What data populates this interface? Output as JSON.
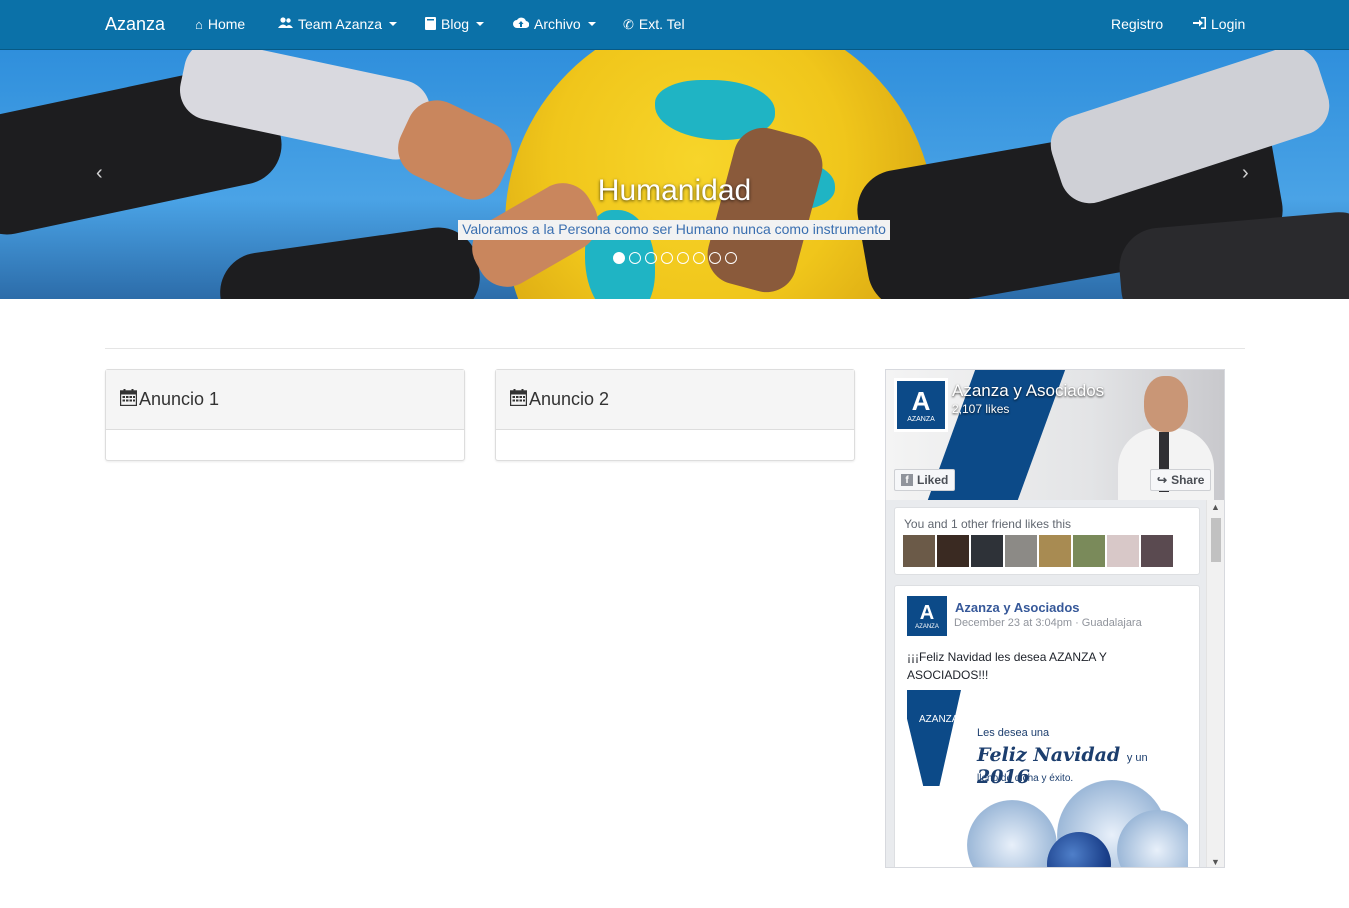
{
  "navbar": {
    "brand": "Azanza",
    "items": [
      {
        "label": "Home",
        "icon": "home-icon"
      },
      {
        "label": "Team Azanza",
        "icon": "users-icon",
        "dropdown": true
      },
      {
        "label": "Blog",
        "icon": "book-icon",
        "dropdown": true
      },
      {
        "label": "Archivo",
        "icon": "cloud-upload-icon",
        "dropdown": true
      },
      {
        "label": "Ext. Tel",
        "icon": "phone-icon"
      }
    ],
    "right": [
      {
        "label": "Registro"
      },
      {
        "label": "Login",
        "icon": "login-icon"
      }
    ]
  },
  "carousel": {
    "title": "Humanidad",
    "subtitle": "Valoramos a la Persona como ser Humano nunca como instrumento",
    "slide_count": 8,
    "active_index": 0,
    "prev": "‹",
    "next": "›"
  },
  "panels": [
    {
      "title": "Anuncio 1",
      "icon": "calendar-icon"
    },
    {
      "title": "Anuncio 2",
      "icon": "calendar-icon"
    }
  ],
  "facebook": {
    "page_name": "Azanza y Asociados",
    "likes": "2,107 likes",
    "logo_letter": "A",
    "logo_sub": "AZANZA",
    "liked_label": "Liked",
    "share_label": "Share",
    "friends_text": "You and 1 other friend likes this",
    "post": {
      "author": "Azanza y Asociados",
      "date": "December 23 at 3:04pm · Guadalajara",
      "text": "¡¡¡Feliz Navidad les desea AZANZA Y ASOCIADOS!!!",
      "image": {
        "brand": "AZANZA",
        "line1": "Les desea una",
        "line2": "Feliz Navidad",
        "line2b": "y un",
        "line2c": "2016",
        "line3": "lleno de dicha y éxito."
      }
    },
    "colors": {
      "brand_blue": "#0c4a88",
      "link": "#365899"
    }
  },
  "colors": {
    "navbar": "#0b71a8"
  }
}
